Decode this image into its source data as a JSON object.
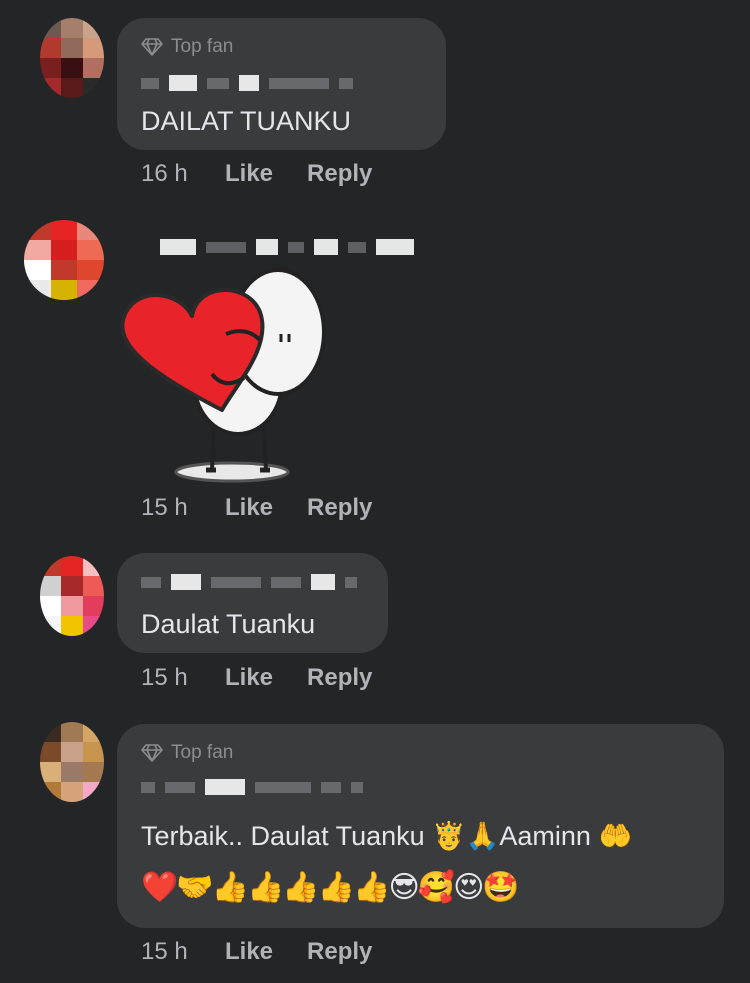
{
  "comments": [
    {
      "badge": "Top fan",
      "text": "DAILAT TUANKU",
      "time": "16 h",
      "like": "Like",
      "reply": "Reply"
    },
    {
      "sticker": "heart-hug-sticker",
      "time": "15 h",
      "like": "Like",
      "reply": "Reply"
    },
    {
      "text": "Daulat Tuanku",
      "time": "15 h",
      "like": "Like",
      "reply": "Reply"
    },
    {
      "badge": "Top fan",
      "text": "Terbaik.. Daulat Tuanku 🤴🙏Aaminn 🤲",
      "emoji_line": "❤️🤝👍👍👍👍👍😎🥰😍🤩",
      "time": "15 h",
      "like": "Like",
      "reply": "Reply"
    }
  ],
  "colors": {
    "background": "#242526",
    "bubble": "#3a3b3c",
    "text": "#e4e6eb",
    "muted": "#b0b3b8",
    "sticker_heart": "#e8232a"
  }
}
